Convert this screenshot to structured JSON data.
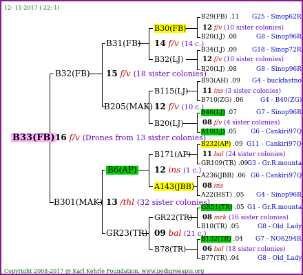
{
  "header_text": "12- 11-2017 ( 22: 1)",
  "footer_text": "Copyright 2008-2017 @ Karl Kehrle Foundation.   www.pedigreeapis.org",
  "root": {
    "code": "B33(FB)",
    "num": "16",
    "suffix": "f/v",
    "note": "(Drones from 13 sister colonies)"
  },
  "gen1": [
    {
      "code": "B32(FB)",
      "num": "15",
      "suffix": "f/v",
      "note": "(18 sister colonies)"
    },
    {
      "code": "B301(MAK)",
      "num": "13",
      "suffix": "/thl",
      "note": "(32 sister colonies)"
    }
  ],
  "gen2": [
    {
      "code": "B31(FB)",
      "num": "14",
      "suffix": "f/v",
      "note": "(14 c.)"
    },
    {
      "code": "B205(MAK)",
      "num": "12",
      "suffix": "f/v",
      "note": "(10 c.)"
    },
    {
      "code": "B6(AP)",
      "num": "12",
      "suffix": "ins",
      "note": "(1 c.)"
    },
    {
      "code": "GR23(TR)",
      "num": "09",
      "suffix": "bal",
      "note": "(21 c.)"
    }
  ],
  "gen3": [
    {
      "code": "B30(FB)",
      "num": "12",
      "suffix": "f/v",
      "note": "(10 sister colonies)"
    },
    {
      "code": "B32(LJ)"
    },
    {
      "code": "B115(LJ)",
      "num": "11",
      "suffix": "ins",
      "note": "(3 sister colonies)"
    },
    {
      "code": "B20(LJ)"
    },
    {
      "code": "B171(AP)",
      "num": "11",
      "suffix": "bal",
      "note": "(24 sister colonies)"
    },
    {
      "code": "A143(JBB)",
      "num": "08",
      "suffix": "ins",
      "note": ""
    },
    {
      "code": "GR22(TR)",
      "num": "08",
      "suffix": "mrk",
      "note": "(16 sister colonies)"
    },
    {
      "code": "B78(TR)",
      "num": "06",
      "suffix": "bal",
      "note": "(18 sister colonies)"
    }
  ],
  "gen4": [
    {
      "code": "B29(FB)",
      "year": ".11",
      "breed": "G25 - Sinop62R"
    },
    {
      "code": "B20(LJ)",
      "year": ".08",
      "breed": "G8 - Sinop96R"
    },
    {
      "code": "B34(LJ)",
      "year": ".09",
      "breed": "G18 - Sinop72R"
    },
    {
      "code": "B20(LJ)",
      "year": ".08",
      "breed": "G8 - Sinop96R"
    },
    {
      "code": "B93(AH)",
      "year": ".09",
      "breed": "G4 - buckfastno"
    },
    {
      "code": "B710(ZG)",
      "year": ".06",
      "breed": "G4 - B40(ZG)"
    },
    {
      "code": "B46(LJ)",
      "year": ".07",
      "breed": "G7 - Sinop96R"
    },
    {
      "code": "A10(LJ)",
      "year": ".05",
      "breed": "G6 - Cankiri97Q"
    },
    {
      "code": "B232(AP)",
      "year": ".09",
      "breed": "G11 - Cankiri97Q"
    },
    {
      "code": "GR109(TR)",
      "year": ".09",
      "breed": "G3 - Gr.R.mounta"
    },
    {
      "code": "A236(JBB)",
      "year": ".06",
      "breed": "G6 - Cankiri97Q"
    },
    {
      "code": "A22(HST)",
      "year": ".05",
      "breed": "G4 - Sinop96R"
    },
    {
      "code": "GR51(TR)",
      "year": ".05",
      "breed": "G1 - Gr.R.mounta"
    },
    {
      "code": "B10(TR)",
      "year": ".05",
      "breed": "G8 - Old_Lady"
    },
    {
      "code": "B132(TR)",
      "year": ".04",
      "breed": "G7 - NO6294R"
    },
    {
      "code": "B77(TR)",
      "year": ".04",
      "breed": "G8 - Old_Lady"
    }
  ],
  "highlight_colors": {
    "pink": "#ffb3ff",
    "yellow": "#ffff00",
    "green": "#00cc00",
    "border": "#8c1a8c"
  }
}
